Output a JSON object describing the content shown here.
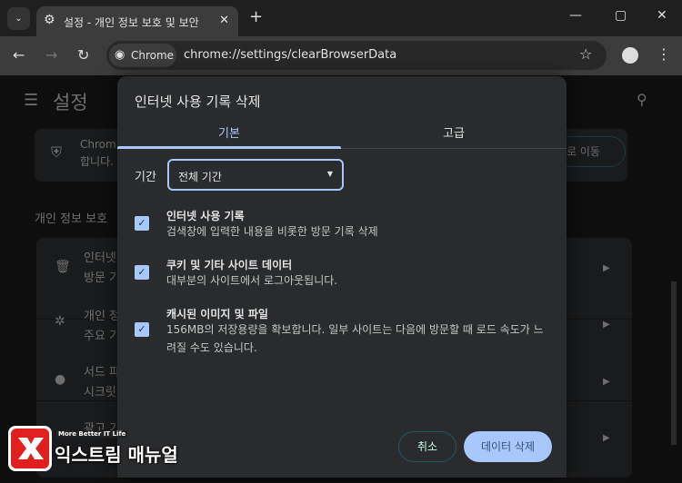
{
  "browser": {
    "tab_title": "설정 - 개인 정보 보호 및 보안",
    "url": "chrome://settings/clearBrowserData",
    "chip_label": "Chrome",
    "icons": [
      "tab-search-icon",
      "gear-icon",
      "close-icon",
      "plus-icon",
      "minimize-icon",
      "maximize-icon",
      "back-icon",
      "forward-icon",
      "reload-icon",
      "star-icon",
      "profile-icon",
      "menu-icon"
    ]
  },
  "settings": {
    "title": "설정",
    "card_line1": "Chrom",
    "card_line2": "합니다.",
    "go_button": "로 이동",
    "section_heading": "개인 정보 보호",
    "rows": [
      {
        "line1": "인터넷",
        "line2": "방문 기"
      },
      {
        "line1": "개인 정",
        "line2": "주요 기"
      },
      {
        "line1": "서드 파",
        "line2": "시크릿"
      },
      {
        "line1": "광고 기",
        "line2": ""
      }
    ]
  },
  "dialog": {
    "title": "인터넷 사용 기록 삭제",
    "tabs": [
      {
        "label": "기본",
        "active": true
      },
      {
        "label": "고급",
        "active": false
      }
    ],
    "period_label": "기간",
    "period_value": "전체 기간",
    "items": [
      {
        "title": "인터넷 사용 기록",
        "desc": "검색창에 입력한 내용을 비롯한 방문 기록 삭제",
        "checked": true
      },
      {
        "title": "쿠키 및 기타 사이트 데이터",
        "desc": "대부분의 사이트에서 로그아웃됩니다.",
        "checked": true
      },
      {
        "title": "캐시된 이미지 및 파일",
        "desc": "156MB의 저장용량을 확보합니다. 일부 사이트는 다음에 방문할 때 로드 속도가 느려질 수도 있습니다.",
        "checked": true
      }
    ],
    "cancel": "취소",
    "delete": "데이터 삭제",
    "accent": "#a8c7fa"
  },
  "watermark": {
    "tagline": "More Better IT Life",
    "name": "익스트림 매뉴얼"
  }
}
